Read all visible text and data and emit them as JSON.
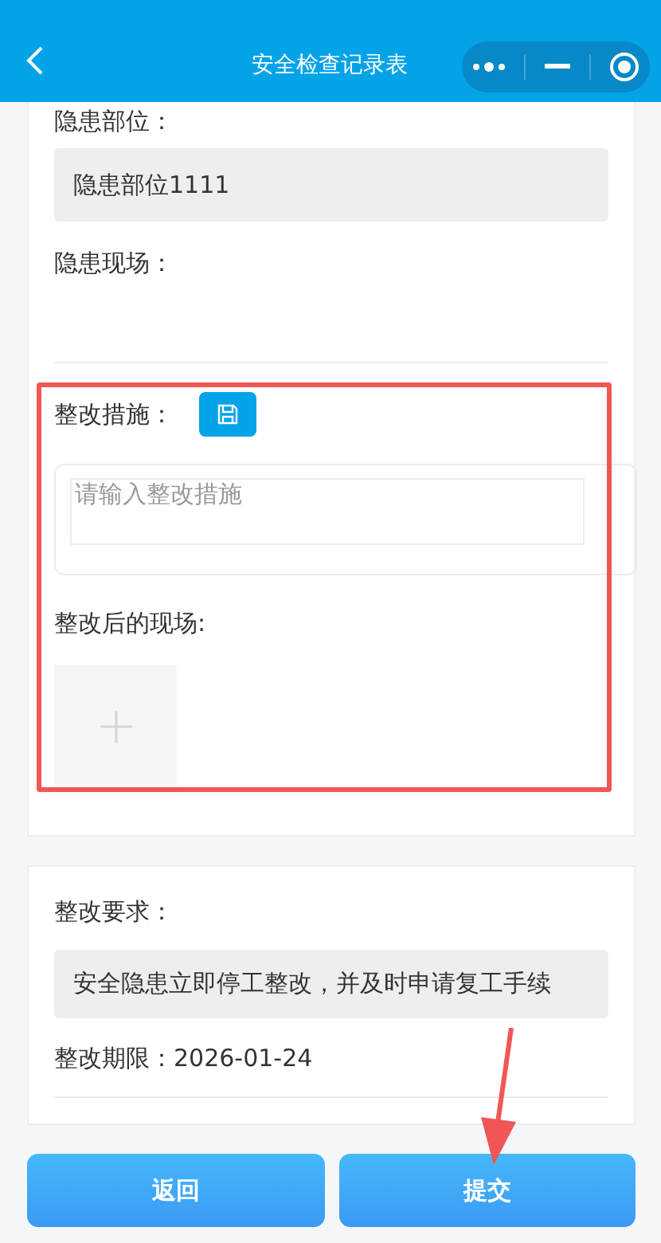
{
  "header": {
    "title": "安全检查记录表"
  },
  "hazard": {
    "location_label": "隐患部位：",
    "location_value": "隐患部位1111",
    "scene_label": "隐患现场："
  },
  "rectification": {
    "measures_label": "整改措施：",
    "measures_placeholder": "请输入整改措施",
    "after_scene_label": "整改后的现场:"
  },
  "requirements": {
    "label": "整改要求：",
    "value": "安全隐患立即停工整改，并及时申请复工手续",
    "deadline": "整改期限：2026-01-24"
  },
  "buttons": [
    {
      "label": "返回"
    },
    {
      "label": "提交"
    }
  ]
}
